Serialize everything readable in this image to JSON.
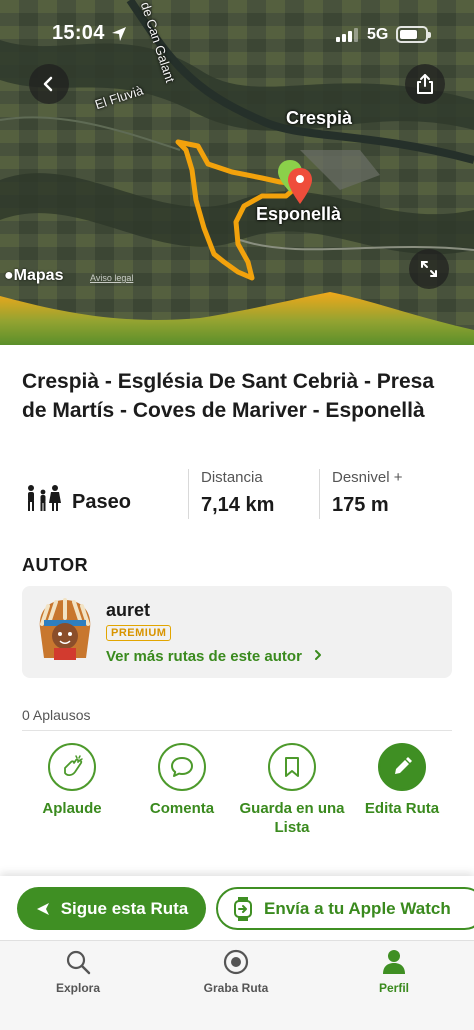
{
  "status": {
    "time": "15:04",
    "network": "5G"
  },
  "map": {
    "labels": {
      "town_top": "Crespià",
      "town_main": "Esponellà",
      "river": "El Fluvià",
      "road": "de Can Galant"
    },
    "attribution": "Mapas",
    "legal": "Aviso legal"
  },
  "route": {
    "title": "Crespià - Església De Sant Cebrià - Presa de Martís - Coves de Mariver - Esponellà",
    "type": "Paseo",
    "distance_label": "Distancia",
    "distance": "7,14 km",
    "elevation_label": "Desnivel +",
    "elevation": "175 m"
  },
  "author_section": {
    "heading": "AUTOR",
    "name": "auret",
    "badge": "PREMIUM",
    "link": "Ver más rutas de este autor"
  },
  "applause": {
    "count_text": "0 Aplausos"
  },
  "actions": [
    {
      "label": "Aplaude",
      "icon": "clap-icon"
    },
    {
      "label": "Comenta",
      "icon": "comment-icon"
    },
    {
      "label": "Guarda en una Lista",
      "icon": "bookmark-icon"
    },
    {
      "label": "Edita Ruta",
      "icon": "pencil-icon"
    }
  ],
  "cta": {
    "follow": "Sigue esta Ruta",
    "watch": "Envía a tu Apple Watch"
  },
  "tabs": [
    {
      "label": "Explora",
      "icon": "search-icon"
    },
    {
      "label": "Graba Ruta",
      "icon": "record-icon"
    },
    {
      "label": "Perfil",
      "icon": "profile-icon",
      "active": true
    }
  ],
  "colors": {
    "brand_green": "#3f8f23",
    "route_orange": "#f2a20c",
    "premium": "#e2a500"
  }
}
